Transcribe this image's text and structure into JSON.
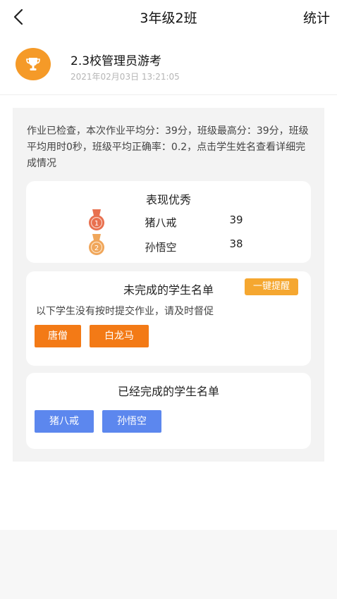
{
  "header": {
    "title": "3年级2班",
    "stats_label": "统计"
  },
  "exam": {
    "name": "2.3校管理员游考",
    "time": "2021年02月03日 13:21:05"
  },
  "summary": "作业已检查，本次作业平均分：39分，班级最高分：39分，班级平均用时0秒，班级平均正确率：0.2，点击学生姓名查看详细完成情况",
  "excellent": {
    "title": "表现优秀",
    "rows": [
      {
        "rank": "1",
        "name": "猪八戒",
        "score": "39"
      },
      {
        "rank": "2",
        "name": "孙悟空",
        "score": "38"
      }
    ]
  },
  "unfinished": {
    "title": "未完成的学生名单",
    "remind_label": "一键提醒",
    "hint": "以下学生没有按时提交作业，请及时督促",
    "students": [
      "唐僧",
      "白龙马"
    ]
  },
  "finished": {
    "title": "已经完成的学生名单",
    "students": [
      "猪八戒",
      "孙悟空"
    ]
  },
  "colors": {
    "accent_orange": "#f37a16",
    "remind_orange": "#f5a730",
    "chip_blue": "#5c87ee",
    "trophy_orange": "#f59a28",
    "gold_medal": "#e8704f",
    "silver_medal": "#f0a65a"
  }
}
